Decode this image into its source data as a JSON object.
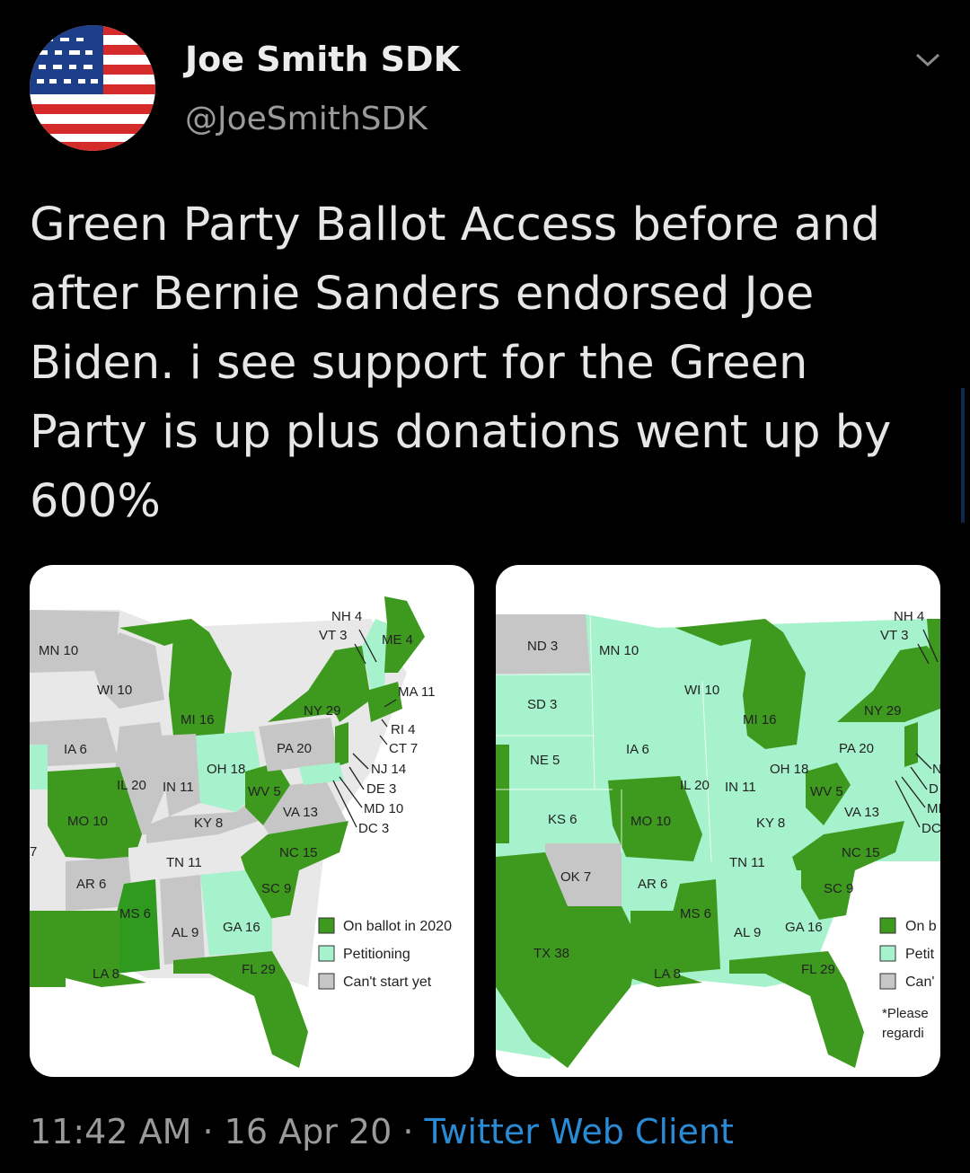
{
  "tweet": {
    "display_name": "Joe Smith SDK",
    "handle": "@JoeSmithSDK",
    "text": "Green Party Ballot Access before and after Bernie Sanders endorsed Joe Biden. i see support for the Green Party is up plus donations went up by 600%",
    "time": "11:42 AM",
    "date": "16 Apr 20",
    "separator": "·",
    "client": "Twitter Web Client"
  },
  "colors": {
    "on_ballot": "#3d9a1e",
    "petitioning": "#a6f2cc",
    "cant_start": "#c6c6c6",
    "link": "#2a8ad4"
  },
  "map_before": {
    "legend": [
      "On ballot in 2020",
      "Petitioning",
      "Can't start yet"
    ],
    "labels": {
      "mn": "MN 10",
      "wi": "WI 10",
      "ia": "IA 6",
      "mi": "MI 16",
      "il": "IL 20",
      "in": "IN 11",
      "oh": "OH 18",
      "mo": "MO 10",
      "ky": "KY 8",
      "wv": "WV 5",
      "va": "VA 13",
      "pa": "PA 20",
      "ny": "NY 29",
      "nh": "NH 4",
      "vt": "VT 3",
      "me": "ME 4",
      "ma": "MA 11",
      "ri": "RI 4",
      "ct": "CT 7",
      "nj": "NJ 14",
      "de": "DE 3",
      "md": "MD 10",
      "dc": "DC 3",
      "nc": "NC 15",
      "tn": "TN 11",
      "ar": "AR 6",
      "sc": "SC 9",
      "ms": "MS 6",
      "al": "AL 9",
      "ga": "GA 16",
      "la": "LA 8",
      "fl": "FL 29",
      "edge": "7"
    }
  },
  "map_after": {
    "legend": [
      "On b",
      "Petit",
      "Can'"
    ],
    "note": [
      "*Please",
      "regardi"
    ],
    "labels": {
      "nd": "ND 3",
      "mn": "MN 10",
      "sd": "SD 3",
      "wi": "WI 10",
      "mi": "MI 16",
      "ne": "NE 5",
      "ia": "IA 6",
      "il": "IL 20",
      "in": "IN 11",
      "oh": "OH 18",
      "pa": "PA 20",
      "ny": "NY 29",
      "nh": "NH 4",
      "vt": "VT 3",
      "ks": "KS 6",
      "mo": "MO 10",
      "ky": "KY 8",
      "wv": "WV 5",
      "va": "VA 13",
      "nc": "NC 15",
      "tn": "TN 11",
      "ok": "OK 7",
      "ar": "AR 6",
      "sc": "SC 9",
      "ms": "MS 6",
      "al": "AL 9",
      "ga": "GA 16",
      "tx": "TX 38",
      "la": "LA 8",
      "fl": "FL 29",
      "n": "N",
      "d": "D",
      "md": "MI",
      "dc": "DC"
    }
  }
}
